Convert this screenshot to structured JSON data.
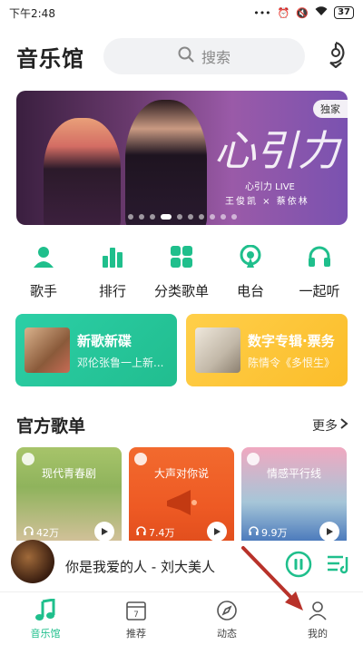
{
  "status_bar": {
    "time": "下午2:48",
    "battery": "37"
  },
  "header": {
    "title": "音乐馆",
    "search_placeholder": "搜索"
  },
  "banner": {
    "badge": "独家",
    "script_text": "心引力",
    "line1": "心引力 LIVE",
    "line2": "王俊凯 × 蔡依林",
    "slide_count": 10,
    "active_slide": 3
  },
  "categories": [
    {
      "label": "歌手",
      "icon": "singer-icon"
    },
    {
      "label": "排行",
      "icon": "chart-icon"
    },
    {
      "label": "分类歌单",
      "icon": "grid-icon"
    },
    {
      "label": "电台",
      "icon": "radio-icon"
    },
    {
      "label": "一起听",
      "icon": "headphones-icon"
    }
  ],
  "cards": [
    {
      "title": "新歌新碟",
      "subtitle": "邓伦张鲁一上新..."
    },
    {
      "title": "数字专辑·票务",
      "subtitle": "陈情令《多恨生》"
    }
  ],
  "section": {
    "title": "官方歌单",
    "more": "更多"
  },
  "playlists": [
    {
      "title": "现代青春剧",
      "count": "42万"
    },
    {
      "title": "大声对你说",
      "count": "7.4万"
    },
    {
      "title": "情感平行线",
      "count": "9.9万"
    }
  ],
  "player": {
    "song": "你是我爱的人 - 刘大美人"
  },
  "tabs": [
    {
      "label": "音乐馆",
      "icon": "music-note-icon",
      "active": true
    },
    {
      "label": "推荐",
      "icon": "calendar-icon",
      "active": false
    },
    {
      "label": "动态",
      "icon": "compass-icon",
      "active": false
    },
    {
      "label": "我的",
      "icon": "person-icon",
      "active": false
    }
  ],
  "colors": {
    "accent": "#1fbf8c",
    "card_green": "#25c69a",
    "card_yellow": "#fcc536"
  }
}
